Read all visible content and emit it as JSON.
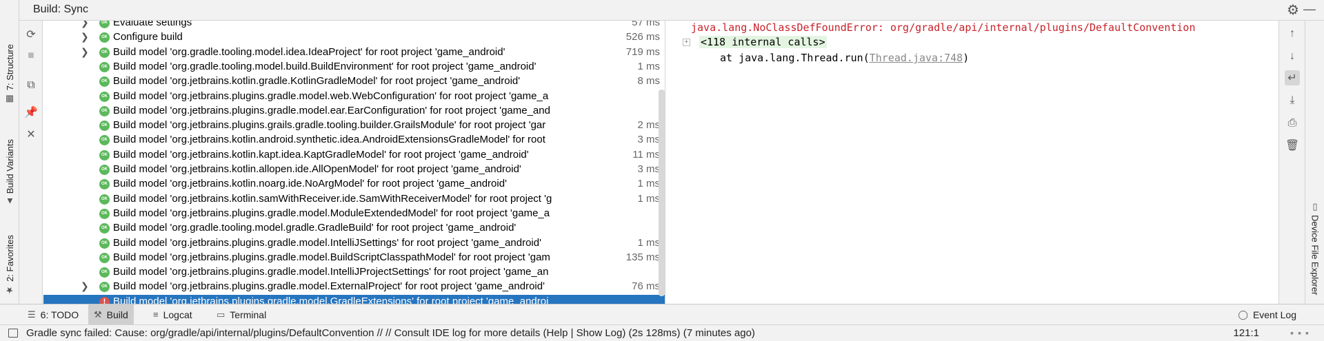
{
  "tool_window": {
    "title": "Build: Sync"
  },
  "left_strip": {
    "tabs": [
      {
        "label": "7: Structure",
        "icon": "structure-icon"
      },
      {
        "label": "Build Variants",
        "icon": "android-icon"
      },
      {
        "label": "2: Favorites",
        "icon": "star-icon"
      }
    ]
  },
  "right_strip": {
    "tabs": [
      {
        "label": "Device File Explorer",
        "icon": "device-icon"
      }
    ]
  },
  "tree": {
    "rows": [
      {
        "label": "Evaluate settings",
        "duration": "57 ms",
        "status": "ok",
        "expandable": true
      },
      {
        "label": "Configure build",
        "duration": "526 ms",
        "status": "ok",
        "expandable": true
      },
      {
        "label": "Build model 'org.gradle.tooling.model.idea.IdeaProject' for root project 'game_android'",
        "duration": "719 ms",
        "status": "ok",
        "expandable": true
      },
      {
        "label": "Build model 'org.gradle.tooling.model.build.BuildEnvironment' for root project 'game_android'",
        "duration": "1 ms",
        "status": "ok",
        "expandable": false
      },
      {
        "label": "Build model 'org.jetbrains.kotlin.gradle.KotlinGradleModel' for root project 'game_android'",
        "duration": "8 ms",
        "status": "ok",
        "expandable": false
      },
      {
        "label": "Build model 'org.jetbrains.plugins.gradle.model.web.WebConfiguration' for root project 'game_a",
        "duration": "",
        "status": "ok",
        "expandable": false
      },
      {
        "label": "Build model 'org.jetbrains.plugins.gradle.model.ear.EarConfiguration' for root project 'game_and",
        "duration": "",
        "status": "ok",
        "expandable": false
      },
      {
        "label": "Build model 'org.jetbrains.plugins.grails.gradle.tooling.builder.GrailsModule' for root project 'gar",
        "duration": "2 ms",
        "status": "ok",
        "expandable": false
      },
      {
        "label": "Build model 'org.jetbrains.kotlin.android.synthetic.idea.AndroidExtensionsGradleModel' for root",
        "duration": "3 ms",
        "status": "ok",
        "expandable": false
      },
      {
        "label": "Build model 'org.jetbrains.kotlin.kapt.idea.KaptGradleModel' for root project 'game_android'",
        "duration": "11 ms",
        "status": "ok",
        "expandable": false
      },
      {
        "label": "Build model 'org.jetbrains.kotlin.allopen.ide.AllOpenModel' for root project 'game_android'",
        "duration": "3 ms",
        "status": "ok",
        "expandable": false
      },
      {
        "label": "Build model 'org.jetbrains.kotlin.noarg.ide.NoArgModel' for root project 'game_android'",
        "duration": "1 ms",
        "status": "ok",
        "expandable": false
      },
      {
        "label": "Build model 'org.jetbrains.kotlin.samWithReceiver.ide.SamWithReceiverModel' for root project 'g",
        "duration": "1 ms",
        "status": "ok",
        "expandable": false
      },
      {
        "label": "Build model 'org.jetbrains.plugins.gradle.model.ModuleExtendedModel' for root project 'game_a",
        "duration": "",
        "status": "ok",
        "expandable": false
      },
      {
        "label": "Build model 'org.gradle.tooling.model.gradle.GradleBuild' for root project 'game_android'",
        "duration": "",
        "status": "ok",
        "expandable": false
      },
      {
        "label": "Build model 'org.jetbrains.plugins.gradle.model.IntelliJSettings' for root project 'game_android'",
        "duration": "1 ms",
        "status": "ok",
        "expandable": false
      },
      {
        "label": "Build model 'org.jetbrains.plugins.gradle.model.BuildScriptClasspathModel' for root project 'gam",
        "duration": "135 ms",
        "status": "ok",
        "expandable": false
      },
      {
        "label": "Build model 'org.jetbrains.plugins.gradle.model.IntelliJProjectSettings' for root project 'game_an",
        "duration": "",
        "status": "ok",
        "expandable": false
      },
      {
        "label": "Build model 'org.jetbrains.plugins.gradle.model.ExternalProject' for root project 'game_android'",
        "duration": "76 ms",
        "status": "ok",
        "expandable": true
      },
      {
        "label": "Build model 'org.jetbrains.plugins.gradle.model.GradleExtensions' for root project 'game_androi",
        "duration": "",
        "status": "error",
        "expandable": false,
        "selected": true
      }
    ]
  },
  "console": {
    "error_line": "java.lang.NoClassDefFoundError: org/gradle/api/internal/plugins/DefaultConvention",
    "internal_calls": "<118 internal calls>",
    "trace_prefix": "at java.lang.Thread.run(",
    "trace_link": "Thread.java:748",
    "trace_suffix": ")"
  },
  "bottom_tabs": [
    {
      "label": "6: TODO",
      "icon": "todo-icon",
      "active": false
    },
    {
      "label": "Build",
      "icon": "build-hammer-icon",
      "active": true
    },
    {
      "label": "Logcat",
      "icon": "logcat-icon",
      "active": false
    },
    {
      "label": "Terminal",
      "icon": "terminal-icon",
      "active": false
    }
  ],
  "event_log": {
    "label": "Event Log",
    "icon": "event-log-icon"
  },
  "status_bar": {
    "message": "Gradle sync failed: Cause: org/gradle/api/internal/plugins/DefaultConvention // // Consult IDE log for more details (Help | Show Log) (2s 128ms) (7 minutes ago)",
    "position": "121:1"
  },
  "colors": {
    "selection": "#2675bf",
    "ok": "#5cb85c",
    "error": "#d9534f",
    "error_text": "#c7222a"
  }
}
